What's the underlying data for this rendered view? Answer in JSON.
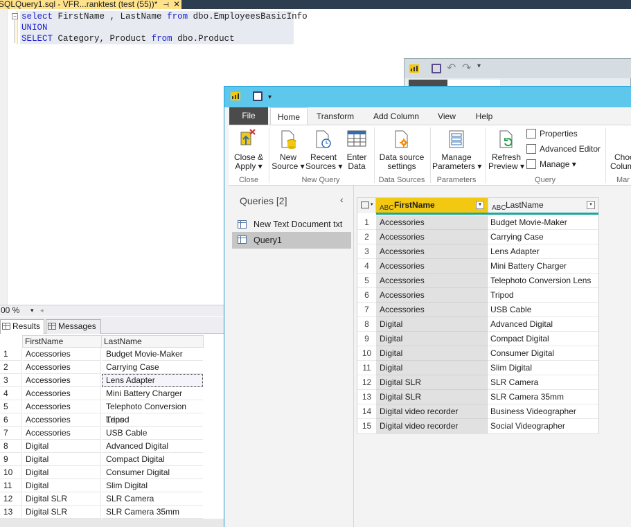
{
  "ssms": {
    "tab_title": "SQLQuery1.sql - VFR...ranktest (test (55))*",
    "pin_glyph": "⊣",
    "close_glyph": "✕",
    "code": {
      "line1": {
        "kw1": "select",
        "cols": "FirstName , LastName",
        "kw2": "from",
        "obj": "dbo.EmployeesBasicInfo"
      },
      "line2": {
        "kw": "UNION"
      },
      "line3": {
        "kw1": "SELECT",
        "cols": "Category, Product",
        "kw2": "from",
        "obj": "dbo.Product"
      }
    },
    "zoom": "00 %",
    "tabs": {
      "results": "Results",
      "messages": "Messages"
    },
    "grid": {
      "headers": [
        "FirstName",
        "LastName"
      ],
      "rows": [
        [
          "1",
          "Accessories",
          "Budget Movie-Maker"
        ],
        [
          "2",
          "Accessories",
          "Carrying Case"
        ],
        [
          "3",
          "Accessories",
          "Lens Adapter"
        ],
        [
          "4",
          "Accessories",
          "Mini Battery Charger"
        ],
        [
          "5",
          "Accessories",
          "Telephoto Conversion Lens"
        ],
        [
          "6",
          "Accessories",
          "Tripod"
        ],
        [
          "7",
          "Accessories",
          "USB Cable"
        ],
        [
          "8",
          "Digital",
          "Advanced Digital"
        ],
        [
          "9",
          "Digital",
          "Compact Digital"
        ],
        [
          "10",
          "Digital",
          "Consumer Digital"
        ],
        [
          "11",
          "Digital",
          "Slim Digital"
        ],
        [
          "12",
          "Digital SLR",
          "SLR Camera"
        ],
        [
          "13",
          "Digital SLR",
          "SLR Camera 35mm"
        ]
      ]
    }
  },
  "pq": {
    "menu": {
      "file": "File",
      "home": "Home",
      "transform": "Transform",
      "add_column": "Add Column",
      "view": "View",
      "help": "Help"
    },
    "ribbon": {
      "close_apply": [
        "Close &",
        "Apply ▾"
      ],
      "new_source": [
        "New",
        "Source ▾"
      ],
      "recent_sources": [
        "Recent",
        "Sources ▾"
      ],
      "enter_data": [
        "Enter",
        "Data"
      ],
      "data_source_settings": [
        "Data source",
        "settings"
      ],
      "manage_parameters": [
        "Manage",
        "Parameters ▾"
      ],
      "refresh_preview": [
        "Refresh",
        "Preview ▾"
      ],
      "properties": "Properties",
      "advanced_editor": "Advanced Editor",
      "manage": "Manage ▾",
      "choose_columns": [
        "Choo",
        "Colum"
      ],
      "groups": {
        "close": "Close",
        "new_query": "New Query",
        "data_sources": "Data Sources",
        "parameters": "Parameters",
        "query": "Query",
        "manage_cols": "Mar"
      }
    },
    "queries": {
      "header": "Queries [2]",
      "collapse": "‹",
      "items": [
        "New Text Document txt",
        "Query1"
      ]
    },
    "grid": {
      "col1": "FirstName",
      "col2": "LastName",
      "type_glyph": "ABC",
      "rows": [
        [
          "1",
          "Accessories",
          "Budget Movie-Maker"
        ],
        [
          "2",
          "Accessories",
          "Carrying Case"
        ],
        [
          "3",
          "Accessories",
          "Lens Adapter"
        ],
        [
          "4",
          "Accessories",
          "Mini Battery Charger"
        ],
        [
          "5",
          "Accessories",
          "Telephoto Conversion Lens"
        ],
        [
          "6",
          "Accessories",
          "Tripod"
        ],
        [
          "7",
          "Accessories",
          "USB Cable"
        ],
        [
          "8",
          "Digital",
          "Advanced Digital"
        ],
        [
          "9",
          "Digital",
          "Compact Digital"
        ],
        [
          "10",
          "Digital",
          "Consumer Digital"
        ],
        [
          "11",
          "Digital",
          "Slim Digital"
        ],
        [
          "12",
          "Digital SLR",
          "SLR Camera"
        ],
        [
          "13",
          "Digital SLR",
          "SLR Camera 35mm"
        ],
        [
          "14",
          "Digital video recorder",
          "Business Videographer"
        ],
        [
          "15",
          "Digital video recorder",
          "Social Videographer"
        ]
      ]
    }
  }
}
